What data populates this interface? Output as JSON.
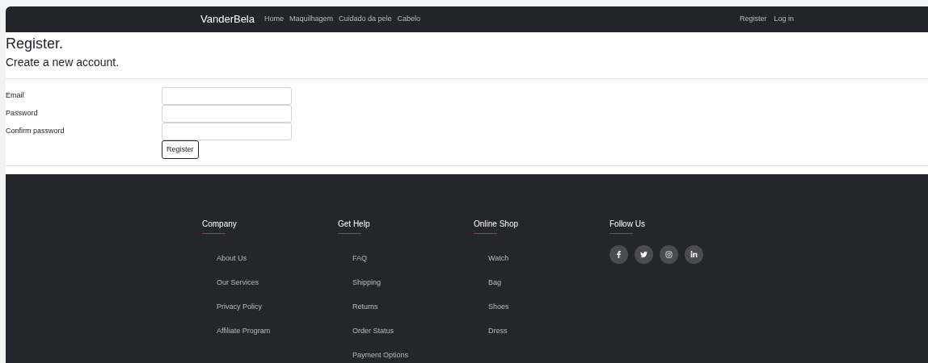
{
  "navbar": {
    "brand": "VanderBela",
    "links": [
      "Home",
      "Maquilhagem",
      "Cuidado da pele",
      "Cabelo"
    ],
    "account_links": [
      "Register",
      "Log in"
    ]
  },
  "page": {
    "title": "Register.",
    "subtitle": "Create a new account."
  },
  "form": {
    "fields": [
      {
        "label": "Email"
      },
      {
        "label": "Password"
      },
      {
        "label": "Confirm password"
      }
    ],
    "submit": "Register"
  },
  "footer": {
    "columns": [
      {
        "heading": "Company",
        "links": [
          "About Us",
          "Our Services",
          "Privacy Policy",
          "Affiliate Program"
        ]
      },
      {
        "heading": "Get Help",
        "links": [
          "FAQ",
          "Shipping",
          "Returns",
          "Order Status",
          "Payment Options"
        ]
      },
      {
        "heading": "Online Shop",
        "links": [
          "Watch",
          "Bag",
          "Shoes",
          "Dress"
        ]
      }
    ],
    "social": {
      "heading": "Follow Us"
    }
  }
}
